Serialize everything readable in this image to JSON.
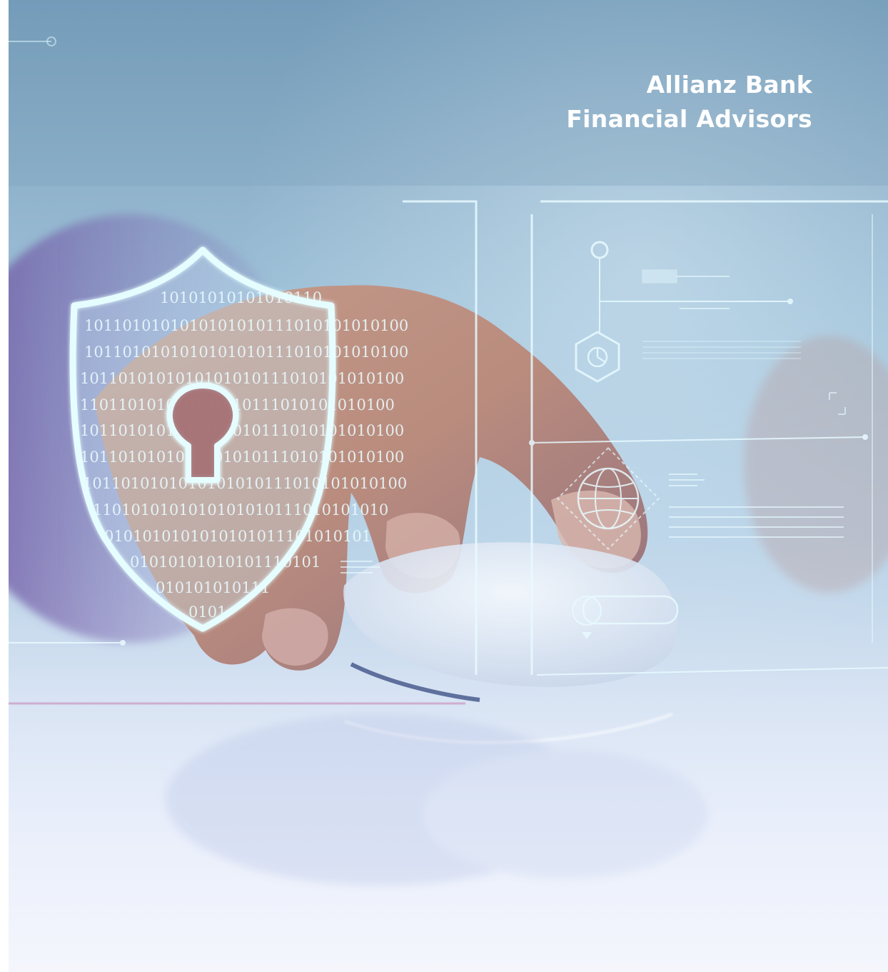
{
  "brand": {
    "line1": "Allianz Bank",
    "line2": "Financial Advisors"
  },
  "image": {
    "description_icons": [
      "shield-lock-icon",
      "globe-icon",
      "pie-chart-icon",
      "computer-mouse"
    ],
    "binary_rows": [
      "10101010101010110",
      "1011010101010101010111010101010100",
      "1011010101010101010111010101010100",
      "1011010101010101010111010101010100",
      "110110101010101010111010101010100",
      "1011010101010101010111010101010100",
      "1011010101010101010111010101010100",
      "1011010101010101010111010101010100",
      "1101010101010101010111010101010",
      "0101010101010101011101010101",
      "01010101010101110101",
      "010101010111",
      "0101"
    ],
    "colors": {
      "overlay_line": "#e8fbff",
      "shield_glow": "#dffcff",
      "brand_text": "#ffffff"
    }
  }
}
